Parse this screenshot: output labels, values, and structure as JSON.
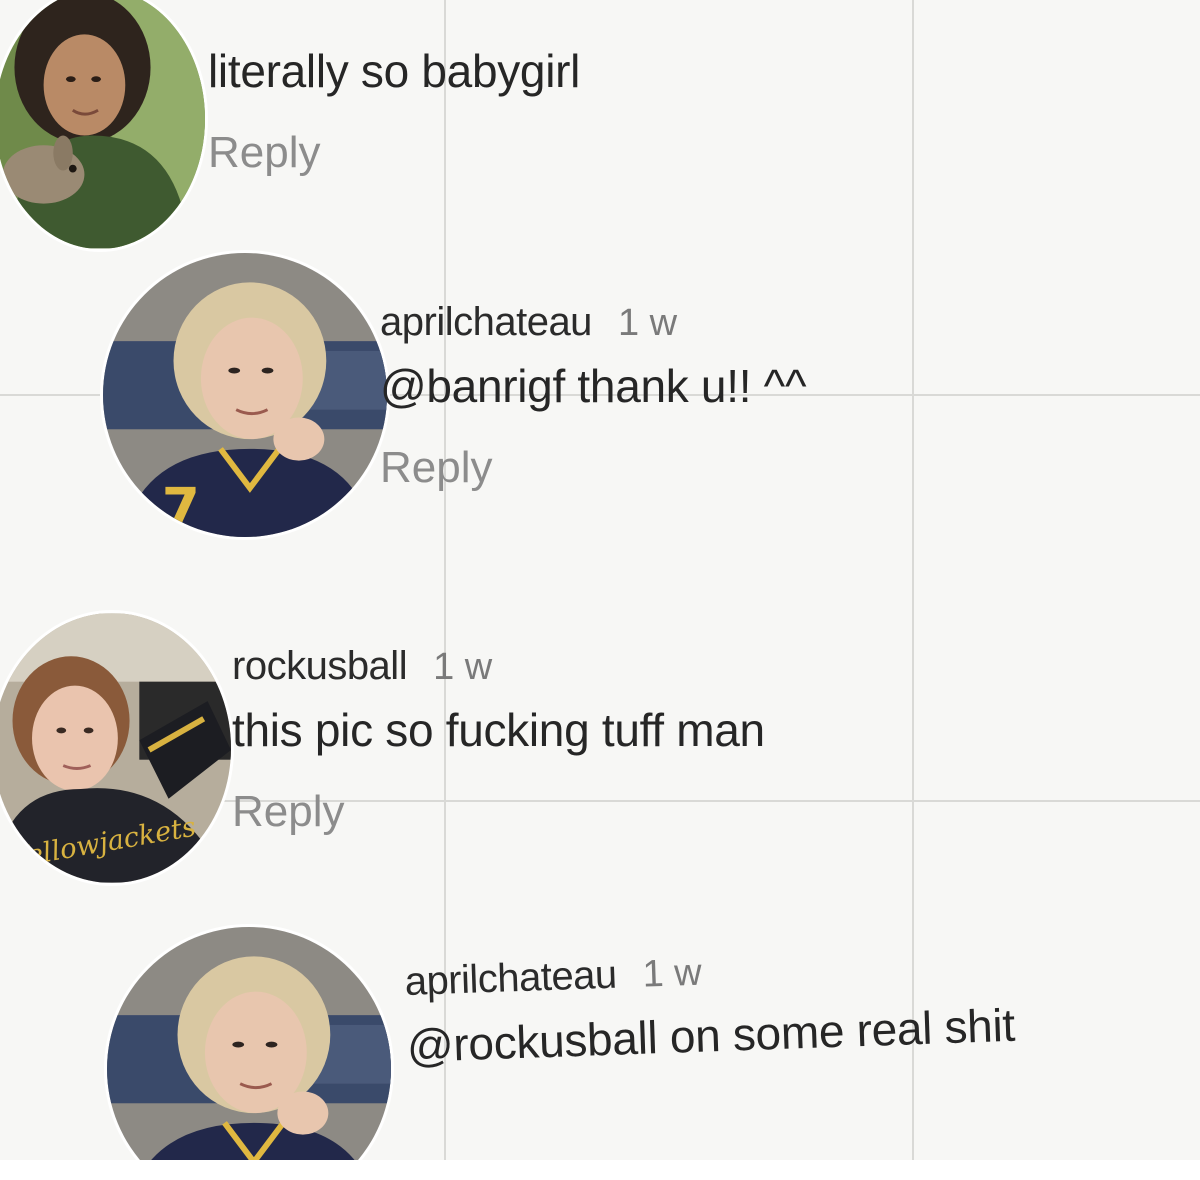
{
  "comments": [
    {
      "username": "",
      "timestamp": "",
      "text": "literally so babygirl",
      "reply_label": "Reply"
    },
    {
      "username": "aprilchateau",
      "timestamp": "1 w",
      "text": "@banrigf thank u!! ^^",
      "reply_label": "Reply"
    },
    {
      "username": "rockusball",
      "timestamp": "1 w",
      "text": "this pic so fucking tuff man",
      "reply_label": "Reply"
    },
    {
      "username": "aprilchateau",
      "timestamp": "1 w",
      "text": "@rockusball on some real shit",
      "reply_label": ""
    }
  ],
  "avatars": [
    {
      "name": "avatar-curly-hair-with-bunny"
    },
    {
      "name": "avatar-blonde-shag-jersey"
    },
    {
      "name": "avatar-ponytail-yellowjackets-sweatshirt"
    },
    {
      "name": "avatar-blonde-shag-jersey"
    }
  ],
  "colors": {
    "background": "#f7f7f5",
    "text": "#262626",
    "muted": "#8c8c8c",
    "grid": "#d9d9d6"
  }
}
